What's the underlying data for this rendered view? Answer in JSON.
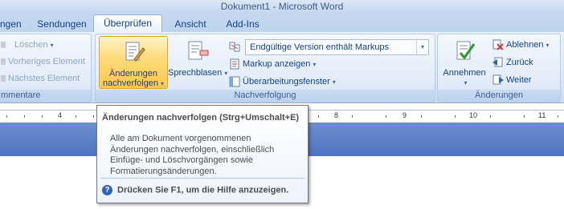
{
  "window": {
    "title": "Dokument1 - Microsoft Word"
  },
  "tabs": [
    {
      "label": "ngen"
    },
    {
      "label": "Sendungen"
    },
    {
      "label": "Überprüfen"
    },
    {
      "label": "Ansicht"
    },
    {
      "label": "Add-Ins"
    }
  ],
  "kommentare": {
    "group_label": "mmentare",
    "delete_label": "Löschen",
    "previous_label": "Vorheriges Element",
    "next_label": "Nächstes Element"
  },
  "nachverfolgung": {
    "group_label": "Nachverfolgung",
    "track_changes_line1": "Änderungen",
    "track_changes_line2": "nachverfolgen",
    "balloons_label": "Sprechblasen",
    "display_combo_value": "Endgültige Version enthält Markups",
    "show_markup_label": "Markup anzeigen",
    "review_pane_label": "Überarbeitungsfenster"
  },
  "aenderungen": {
    "group_label": "Änderungen",
    "accept_label": "Annehmen",
    "reject_label": "Ablehnen",
    "back_label": "Zurück",
    "forward_label": "Weiter"
  },
  "ruler": {
    "numbers": [
      "4",
      "8",
      "9",
      "10",
      "11"
    ]
  },
  "tooltip": {
    "title": "Änderungen nachverfolgen (Strg+Umschalt+E)",
    "body_line1": "Alle am Dokument vorgenommenen",
    "body_line2": "Änderungen nachverfolgen, einschließlich",
    "body_line3": "Einfüge- und Löschvorgängen sowie",
    "body_line4": "Formatierungsänderungen.",
    "help": "Drücken Sie F1, um die Hilfe anzuzeigen."
  }
}
